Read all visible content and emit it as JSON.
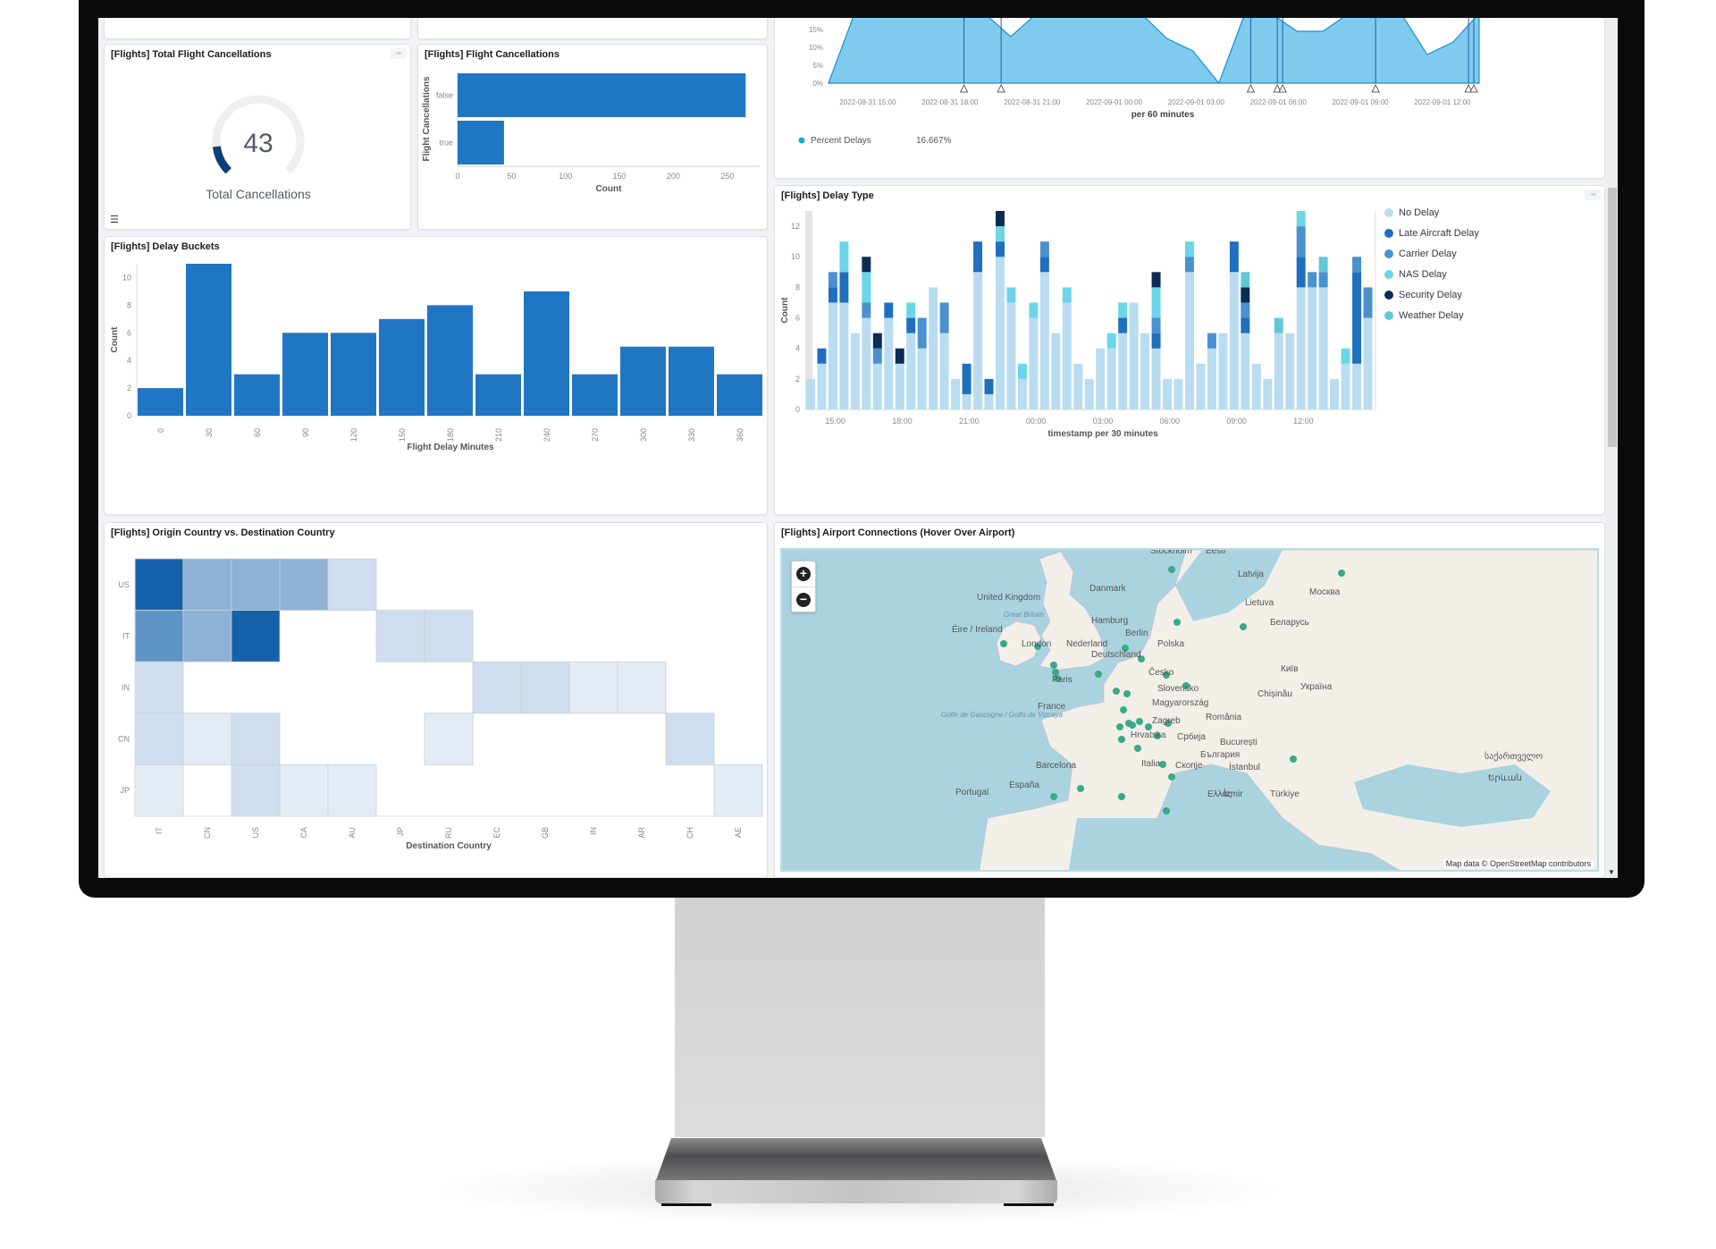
{
  "panels": {
    "total_cancellations": {
      "title": "[Flights] Total Flight Cancellations",
      "metric_value": "43",
      "metric_label": "Total Cancellations",
      "gauge_fraction": 0.14,
      "menu_icon": "options-dots-icon",
      "legend_toggle_icon": "list-icon"
    },
    "flight_cancellations": {
      "title": "[Flights] Flight Cancellations"
    },
    "percent_delays": {
      "legend_label": "Percent Delays",
      "legend_value": "16.667%",
      "xlabel": "per 60 minutes"
    },
    "delay_buckets": {
      "title": "[Flights] Delay Buckets"
    },
    "delay_type": {
      "title": "[Flights] Delay Type",
      "menu_icon": "options-dots-icon"
    },
    "origin_dest": {
      "title": "[Flights] Origin Country vs. Destination Country"
    },
    "airport_map": {
      "title": "[Flights] Airport Connections (Hover Over Airport)",
      "zoom_in_label": "+",
      "zoom_out_label": "−",
      "attribution": "Map data © OpenStreetMap contributors",
      "labels": [
        {
          "text": "United Kingdom"
        },
        {
          "text": "Great Britain",
          "italic": true
        },
        {
          "text": "Éire / Ireland"
        },
        {
          "text": "London"
        },
        {
          "text": "Nederland"
        },
        {
          "text": "Paris"
        },
        {
          "text": "France"
        },
        {
          "text": "Golfe de Gascogne / Golfo de Vizcaya",
          "italic": true
        },
        {
          "text": "Barcelona"
        },
        {
          "text": "España"
        },
        {
          "text": "Portugal"
        },
        {
          "text": "Danmark"
        },
        {
          "text": "Hamburg"
        },
        {
          "text": "Berlin"
        },
        {
          "text": "Deutschland"
        },
        {
          "text": "Polska"
        },
        {
          "text": "Česko"
        },
        {
          "text": "Slovensko"
        },
        {
          "text": "Magyarország"
        },
        {
          "text": "Zagreb"
        },
        {
          "text": "Hrvatska"
        },
        {
          "text": "Србија"
        },
        {
          "text": "România"
        },
        {
          "text": "București"
        },
        {
          "text": "България"
        },
        {
          "text": "Скопје"
        },
        {
          "text": "Italia"
        },
        {
          "text": "Ελλάς"
        },
        {
          "text": "İzmir"
        },
        {
          "text": "İstanbul"
        },
        {
          "text": "Türkiye"
        },
        {
          "text": "Chișinău"
        },
        {
          "text": "Україна"
        },
        {
          "text": "Київ"
        },
        {
          "text": "Беларусь"
        },
        {
          "text": "Lietuva"
        },
        {
          "text": "Latvija"
        },
        {
          "text": "Москва"
        },
        {
          "text": "Eesti"
        },
        {
          "text": "Stockholm"
        },
        {
          "text": "საქართველო"
        },
        {
          "text": "Երևան"
        }
      ]
    }
  },
  "chart_data": [
    {
      "id": "flight_cancellations",
      "type": "bar",
      "orientation": "horizontal",
      "title": "[Flights] Flight Cancellations",
      "categories": [
        "false",
        "true"
      ],
      "values": [
        267,
        43
      ],
      "xlabel": "Count",
      "ylabel": "Flight Cancellations",
      "xlim": [
        0,
        280
      ],
      "xticks": [
        0,
        50,
        100,
        150,
        200,
        250
      ],
      "color": "#2176c3"
    },
    {
      "id": "percent_delays",
      "type": "area",
      "title": "",
      "xlabel": "per 60 minutes",
      "ylabel": "",
      "yticks": [
        "0%",
        "5%",
        "10%",
        "15%"
      ],
      "ylim": [
        0,
        15
      ],
      "xtick_labels": [
        "2022-08-31 15:00",
        "2022-08-31 18:00",
        "2022-08-31 21:00",
        "2022-09-01 00:00",
        "2022-09-01 03:00",
        "2022-09-01 06:00",
        "2022-09-01 09:00",
        "2022-09-01 12:00"
      ],
      "x_hours": [
        0,
        1,
        2,
        3,
        4,
        5,
        6,
        7,
        8,
        9,
        10,
        11,
        12,
        13,
        14,
        15,
        16,
        17,
        18,
        19,
        20,
        21,
        22,
        23,
        24
      ],
      "values": [
        0,
        16,
        16,
        16,
        16,
        16,
        16,
        13,
        16,
        16,
        16,
        16,
        16,
        12.5,
        9,
        0,
        16,
        16,
        14.5,
        14.5,
        16,
        16,
        16,
        8,
        11.5,
        16
      ],
      "annotation_hours": [
        5.1,
        6.5,
        15.9,
        16.9,
        17.1,
        20.6,
        24.1,
        24.3
      ],
      "legend": [
        {
          "name": "Percent Delays",
          "value": "16.667%",
          "color": "#1ea5d6"
        }
      ],
      "fill_color": "#7fcbee",
      "line_color": "#1a8fcc"
    },
    {
      "id": "delay_buckets",
      "type": "bar",
      "title": "[Flights] Delay Buckets",
      "categories": [
        "0",
        "30",
        "60",
        "90",
        "120",
        "150",
        "180",
        "210",
        "240",
        "270",
        "300",
        "330",
        "360"
      ],
      "values": [
        2,
        11,
        3,
        6,
        6,
        7,
        8,
        3,
        9,
        3,
        5,
        5,
        3
      ],
      "xlabel": "Flight Delay Minutes",
      "ylabel": "Count",
      "ylim": [
        0,
        11
      ],
      "yticks": [
        0,
        2,
        4,
        6,
        8,
        10
      ],
      "color": "#2176c3"
    },
    {
      "id": "delay_type",
      "type": "bar",
      "stacked": true,
      "title": "[Flights] Delay Type",
      "xlabel": "timestamp per 30 minutes",
      "ylabel": "Count",
      "ylim": [
        0,
        13
      ],
      "yticks": [
        0,
        2,
        4,
        6,
        8,
        10,
        12
      ],
      "xtick_labels": [
        "15:00",
        "18:00",
        "21:00",
        "00:00",
        "03:00",
        "06:00",
        "09:00",
        "12:00"
      ],
      "xtick_bar_index": [
        3,
        9,
        15,
        21,
        27,
        33,
        39,
        45
      ],
      "series": [
        {
          "name": "No Delay",
          "color": "#b9dcf0",
          "values": [
            2,
            3,
            7,
            7,
            5,
            6,
            3,
            6,
            3,
            5,
            4,
            8,
            5,
            2,
            1,
            9,
            1,
            10,
            7,
            2,
            6,
            9,
            5,
            7,
            3,
            2,
            4,
            4,
            5,
            7,
            5,
            4,
            2,
            2,
            9,
            3,
            4,
            5,
            9,
            5,
            3,
            2,
            5,
            5,
            8,
            8,
            8,
            2,
            3,
            3,
            6
          ]
        },
        {
          "name": "Late Aircraft Delay",
          "color": "#1f6fbf",
          "values": [
            0,
            1,
            1,
            2,
            0,
            0,
            0,
            1,
            0,
            1,
            0,
            0,
            0,
            0,
            2,
            2,
            1,
            1,
            0,
            0,
            0,
            1,
            0,
            0,
            0,
            0,
            0,
            0,
            1,
            0,
            0,
            1,
            0,
            0,
            0,
            0,
            0,
            0,
            2,
            1,
            0,
            0,
            0,
            0,
            2,
            0,
            0,
            0,
            0,
            6,
            0
          ]
        },
        {
          "name": "Carrier Delay",
          "color": "#4a91cf",
          "values": [
            0,
            0,
            1,
            0,
            0,
            1,
            1,
            0,
            0,
            0,
            2,
            0,
            2,
            0,
            0,
            0,
            0,
            0,
            0,
            0,
            0,
            1,
            0,
            0,
            0,
            0,
            0,
            0,
            0,
            0,
            0,
            1,
            0,
            0,
            1,
            0,
            1,
            0,
            0,
            1,
            0,
            0,
            0,
            0,
            2,
            1,
            1,
            0,
            0,
            1,
            2
          ]
        },
        {
          "name": "NAS Delay",
          "color": "#6ad6e8",
          "values": [
            0,
            0,
            0,
            2,
            0,
            2,
            0,
            0,
            0,
            1,
            0,
            0,
            0,
            0,
            0,
            0,
            0,
            1,
            1,
            1,
            1,
            0,
            0,
            1,
            0,
            0,
            0,
            1,
            1,
            0,
            0,
            2,
            0,
            0,
            1,
            0,
            0,
            0,
            0,
            0,
            0,
            0,
            0,
            0,
            1,
            0,
            0,
            0,
            1,
            0,
            0
          ]
        },
        {
          "name": "Security Delay",
          "color": "#0b2d55",
          "values": [
            0,
            0,
            0,
            0,
            0,
            1,
            1,
            0,
            1,
            0,
            0,
            0,
            0,
            0,
            0,
            0,
            0,
            1,
            0,
            0,
            0,
            0,
            0,
            0,
            0,
            0,
            0,
            0,
            0,
            0,
            0,
            1,
            0,
            0,
            0,
            0,
            0,
            0,
            0,
            1,
            0,
            0,
            0,
            0,
            0,
            0,
            0,
            0,
            0,
            0,
            0
          ]
        },
        {
          "name": "Weather Delay",
          "color": "#62c8d6",
          "values": [
            0,
            0,
            0,
            0,
            0,
            0,
            0,
            0,
            0,
            0,
            0,
            0,
            0,
            0,
            0,
            0,
            0,
            0,
            0,
            0,
            0,
            0,
            0,
            0,
            0,
            0,
            0,
            0,
            0,
            0,
            0,
            0,
            0,
            0,
            0,
            0,
            0,
            0,
            0,
            1,
            0,
            0,
            1,
            0,
            0,
            0,
            1,
            0,
            0,
            0,
            0
          ]
        }
      ]
    },
    {
      "id": "origin_dest",
      "type": "heatmap",
      "title": "[Flights] Origin Country vs. Destination Country",
      "xlabel": "Destination Country",
      "ylabel": "",
      "x_categories": [
        "IT",
        "CN",
        "US",
        "CA",
        "AU",
        "JP",
        "RU",
        "EC",
        "GB",
        "IN",
        "AR",
        "CH",
        "AE"
      ],
      "y_categories": [
        "US",
        "IT",
        "IN",
        "CN",
        "JP"
      ],
      "values": [
        [
          10,
          5,
          5,
          5,
          2,
          0,
          0,
          0,
          0,
          0,
          0,
          0,
          0
        ],
        [
          7,
          5,
          10,
          0,
          0,
          2,
          2,
          0,
          0,
          0,
          0,
          0,
          0
        ],
        [
          2,
          0,
          0,
          0,
          0,
          0,
          0,
          2,
          2,
          1,
          1,
          0,
          0
        ],
        [
          2,
          1,
          2,
          0,
          0,
          0,
          1,
          0,
          0,
          0,
          0,
          2,
          0
        ],
        [
          1,
          0,
          2,
          1,
          1,
          0,
          0,
          0,
          0,
          0,
          0,
          0,
          1
        ]
      ],
      "color_max": "#1662aa",
      "color_min": "#f5f8fc"
    }
  ]
}
